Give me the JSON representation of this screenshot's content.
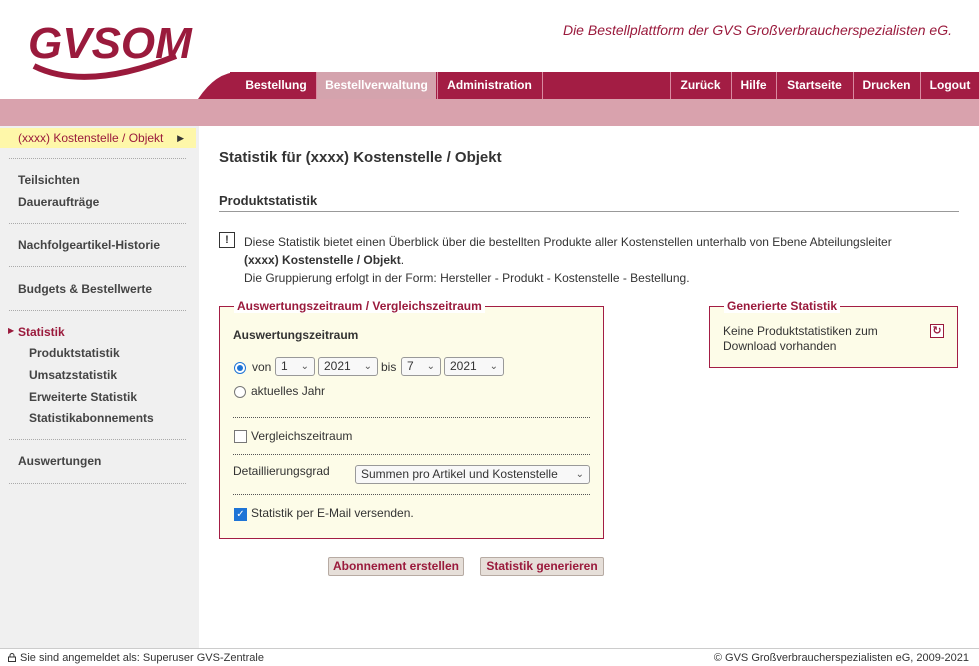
{
  "header": {
    "logo_text": "GVSOM",
    "tagline": "Die Bestellplattform der GVS Großverbraucherspezialisten eG."
  },
  "nav": {
    "left": [
      "Bestellung",
      "Bestellverwaltung",
      "Administration"
    ],
    "right": [
      "Zurück",
      "Hilfe",
      "Startseite",
      "Drucken",
      "Logout"
    ],
    "active": "Bestellverwaltung"
  },
  "sidebar": {
    "context": "(xxxx) Kostenstelle / Objekt",
    "items": [
      "Teilsichten",
      "Daueraufträge",
      "Nachfolgeartikel-Historie",
      "Budgets & Bestellwerte",
      "Statistik",
      "Auswertungen"
    ],
    "sub_items": [
      "Produktstatistik",
      "Umsatzstatistik",
      "Erweiterte Statistik",
      "Statistikabonnements"
    ]
  },
  "main": {
    "title": "Statistik für (xxxx) Kostenstelle / Objekt",
    "section": "Produktstatistik",
    "info_icon": "!",
    "info_line1": "Diese Statistik bietet einen Überblick über die bestellten Produkte aller Kostenstellen unterhalb von Ebene Abteilungsleiter",
    "info_bold": "(xxxx) Kostenstelle / Objekt",
    "info_line2_end": ".",
    "info_line3": "Die Gruppierung erfolgt in der Form: Hersteller - Produkt - Kostenstelle - Bestellung."
  },
  "form": {
    "legend": "Auswertungszeitraum / Vergleichszeitraum",
    "period_heading": "Auswertungszeitraum",
    "from_label": "von",
    "to_label": "bis",
    "from_month": "1",
    "from_year": "2021",
    "to_month": "7",
    "to_year": "2021",
    "current_year_label": "aktuelles Jahr",
    "compare_label": "Vergleichszeitraum",
    "detail_label": "Detaillierungsgrad",
    "detail_value": "Summen pro Artikel und Kostenstelle",
    "email_label": "Statistik per E-Mail versenden."
  },
  "generated": {
    "legend": "Generierte Statistik",
    "text_line1": "Keine Produktstatistiken zum",
    "text_line2": "Download vorhanden"
  },
  "buttons": {
    "subscribe": "Abonnement erstellen",
    "generate": "Statistik generieren"
  },
  "footer": {
    "left": "Sie sind angemeldet als: Superuser GVS-Zentrale",
    "right": "© GVS Großverbraucherspezialisten eG, 2009-2021"
  },
  "colors": {
    "brand": "#a31d44",
    "band": "#d9a2ad",
    "context_bg": "#fef7a9",
    "fieldset_bg": "#fdfce8"
  }
}
